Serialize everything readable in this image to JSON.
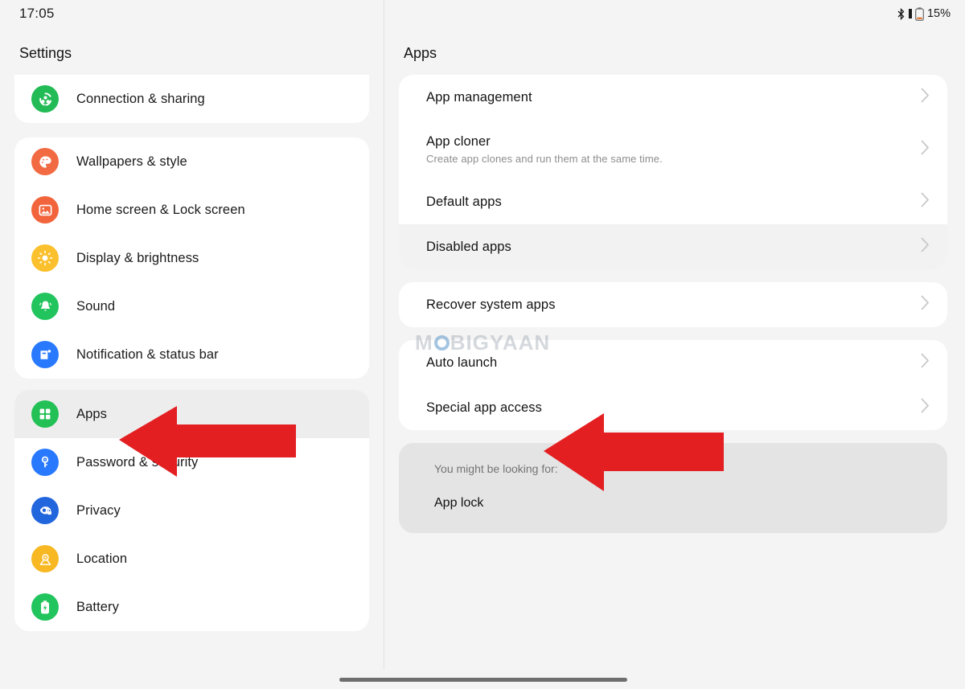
{
  "status_bar": {
    "time": "17:05",
    "bluetooth_icon": "bluetooth-icon",
    "signal_icon": "signal-bar-icon",
    "battery_icon": "battery-icon",
    "battery_percent": "15%"
  },
  "sidebar": {
    "title": "Settings",
    "groups": [
      {
        "id": "group-connection",
        "items": [
          {
            "label": "Connection & sharing",
            "icon": "connection-sharing-icon",
            "color": "#22bb55",
            "selected": false
          }
        ]
      },
      {
        "id": "group-personalization",
        "items": [
          {
            "label": "Wallpapers & style",
            "icon": "palette-icon",
            "color": "#f26a42",
            "selected": false
          },
          {
            "label": "Home screen & Lock screen",
            "icon": "image-icon",
            "color": "#f2653c",
            "selected": false
          },
          {
            "label": "Display & brightness",
            "icon": "brightness-icon",
            "color": "#fbc02d",
            "selected": false
          },
          {
            "label": "Sound",
            "icon": "bell-icon",
            "color": "#21c45d",
            "selected": false
          },
          {
            "label": "Notification & status bar",
            "icon": "notification-icon",
            "color": "#2979ff",
            "selected": false
          }
        ]
      },
      {
        "id": "group-system",
        "items": [
          {
            "label": "Apps",
            "icon": "apps-grid-icon",
            "color": "#22c055",
            "selected": true
          },
          {
            "label": "Password & security",
            "icon": "key-icon",
            "color": "#2979ff",
            "selected": false
          },
          {
            "label": "Privacy",
            "icon": "privacy-eye-icon",
            "color": "#2266dd",
            "selected": false
          },
          {
            "label": "Location",
            "icon": "location-pin-icon",
            "color": "#f7b824",
            "selected": false
          },
          {
            "label": "Battery",
            "icon": "battery-charge-icon",
            "color": "#21c45d",
            "selected": false
          }
        ]
      }
    ]
  },
  "content": {
    "title": "Apps",
    "cards": [
      {
        "id": "card-apps-main",
        "rows": [
          {
            "label": "App management",
            "sub": "",
            "chevron": "chevron-right-icon",
            "shaded": false
          },
          {
            "label": "App cloner",
            "sub": "Create app clones and run them at the same time.",
            "chevron": "chevron-right-icon",
            "shaded": false
          },
          {
            "label": "Default apps",
            "sub": "",
            "chevron": "chevron-right-icon",
            "shaded": false
          },
          {
            "label": "Disabled apps",
            "sub": "",
            "chevron": "chevron-right-icon",
            "shaded": true
          }
        ]
      },
      {
        "id": "card-recover",
        "rows": [
          {
            "label": "Recover system apps",
            "sub": "",
            "chevron": "chevron-right-icon",
            "shaded": false
          }
        ]
      },
      {
        "id": "card-access",
        "rows": [
          {
            "label": "Auto launch",
            "sub": "",
            "chevron": "chevron-right-icon",
            "shaded": false
          },
          {
            "label": "Special app access",
            "sub": "",
            "chevron": "chevron-right-icon",
            "shaded": false
          }
        ]
      }
    ],
    "hint": {
      "heading": "You might be looking for:",
      "items": [
        "App lock"
      ]
    }
  },
  "annotations": {
    "arrow_color": "#e41f21",
    "arrows": [
      {
        "name": "arrow-pointing-apps",
        "target": "Apps"
      },
      {
        "name": "arrow-pointing-special-app-access",
        "target": "Special app access"
      }
    ]
  },
  "watermark": {
    "text_before": "M",
    "text_after": "BIGYAAN"
  },
  "navigation": {
    "gesture_bar": "home-indicator"
  }
}
